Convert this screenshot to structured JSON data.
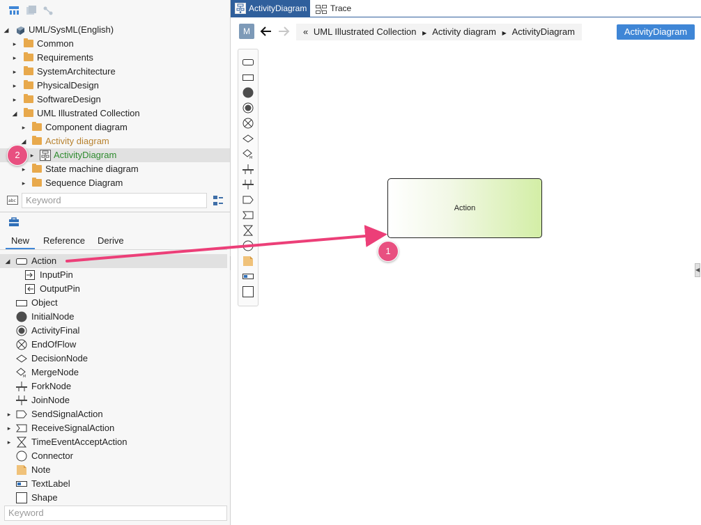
{
  "tree": {
    "root": "UML/SysML(English)",
    "items": [
      {
        "label": "Common",
        "level": 1
      },
      {
        "label": "Requirements",
        "level": 1
      },
      {
        "label": "SystemArchitecture",
        "level": 1
      },
      {
        "label": "PhysicalDesign",
        "level": 1
      },
      {
        "label": "SoftwareDesign",
        "level": 1
      },
      {
        "label": "UML Illustrated Collection",
        "level": 1
      },
      {
        "label": "Component diagram",
        "level": 2
      },
      {
        "label": "Activity diagram",
        "level": 2
      },
      {
        "label": "ActivityDiagram",
        "level": 3
      },
      {
        "label": "State machine diagram",
        "level": 2
      },
      {
        "label": "Sequence Diagram",
        "level": 2
      }
    ],
    "keyword_placeholder": "Keyword"
  },
  "palette": {
    "tabs": [
      "New",
      "Reference",
      "Derive"
    ],
    "active_tab": "New",
    "items": [
      "Action",
      "InputPin",
      "OutputPin",
      "Object",
      "InitialNode",
      "ActivityFinal",
      "EndOfFlow",
      "DecisionNode",
      "MergeNode",
      "ForkNode",
      "JoinNode",
      "SendSignalAction",
      "ReceiveSignalAction",
      "TimeEventAcceptAction",
      "Connector",
      "Note",
      "TextLabel",
      "Shape"
    ],
    "keyword_placeholder": "Keyword"
  },
  "editor": {
    "tabs": [
      "ActivityDiagram",
      "Trace"
    ],
    "active_tab": "ActivityDiagram",
    "m_button": "M",
    "breadcrumb_prefix": "«",
    "breadcrumb": [
      "UML Illustrated Collection",
      "Activity diagram",
      "ActivityDiagram"
    ],
    "diagram_button": "ActivityDiagram",
    "action_node_label": "Action"
  },
  "callouts": [
    "1",
    "2"
  ],
  "colors": {
    "accent": "#3f86d6",
    "badge": "#e85080",
    "arrow": "#ec3f78",
    "folder": "#e8a94c",
    "tree_folder_active": "#b8822f",
    "tree_item_selected": "#2e8b2e"
  }
}
